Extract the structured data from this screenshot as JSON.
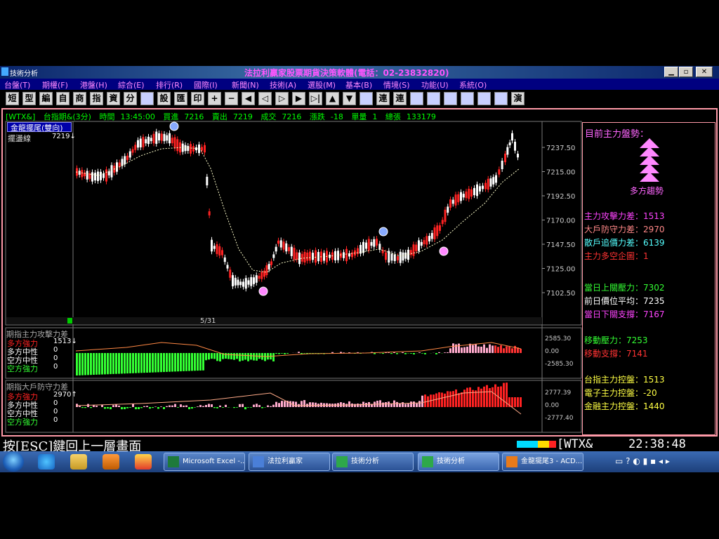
{
  "window": {
    "app_label": "技術分析",
    "title": "法拉利贏家股票期貨決策軟體(電話：02-23832820)",
    "min": "▁",
    "max": "▫",
    "close": "✕"
  },
  "menu": [
    "台盤(T)",
    "期權(F)",
    "港盤(H)",
    "綜合(E)",
    "排行(R)",
    "國際(I)",
    "新聞(N)",
    "技術(A)",
    "選股(M)",
    "基本(B)",
    "情境(S)",
    "功能(U)",
    "系統(O)"
  ],
  "toolbar": [
    "短",
    "型",
    "編",
    "自",
    "商",
    "指",
    "資",
    "分",
    "",
    "設",
    "匯",
    "印",
    "+",
    "−",
    "◀",
    "◁",
    "▷",
    "▶",
    "▷|",
    "▲",
    "▼",
    "",
    "連",
    "連",
    "",
    "",
    "",
    "",
    "",
    "",
    " 演"
  ],
  "infobar": {
    "symbol": "[WTX&]",
    "name": "台指期&(3分)",
    "time_label": "時間",
    "time": "13:45:00",
    "bid_label": "買進",
    "bid": "7216",
    "ask_label": "賣出",
    "ask": "7219",
    "deal_label": "成交",
    "deal": "7216",
    "chg_label": "漲跌",
    "chg": "-18",
    "vol_label": "單量",
    "vol": "1",
    "total_label": "總張",
    "total": "133179"
  },
  "main_panel": {
    "indicator_title": "金龍擺尾(雙向)",
    "filter_label": "擺盪線",
    "filter_value": "7219↓",
    "date_label": "5/31",
    "y_ticks": [
      "7237.50",
      "7215.00",
      "7192.50",
      "7170.00",
      "7147.50",
      "7125.00",
      "7102.50"
    ]
  },
  "attack_panel": {
    "title": "期指主力攻擊力差",
    "rows": [
      {
        "label": "多方強力",
        "value": "1513↓"
      },
      {
        "label": "多方中性",
        "value": "0"
      },
      {
        "label": "空方中性",
        "value": "0"
      },
      {
        "label": "空方強力",
        "value": "0"
      }
    ],
    "y_ticks": [
      "2585.30",
      "0.00",
      "-2585.30"
    ]
  },
  "defense_panel": {
    "title": "期指大戶防守力差",
    "rows": [
      {
        "label": "多方強力",
        "value": "2970↑"
      },
      {
        "label": "多方中性",
        "value": "0"
      },
      {
        "label": "空方中性",
        "value": "0"
      },
      {
        "label": "空方強力",
        "value": "0"
      }
    ],
    "y_ticks": [
      "2777.39",
      "0.00",
      "-2777.40"
    ]
  },
  "right_panel": {
    "trend_title": "目前主力盤勢：",
    "trend_label": "多方趨勢",
    "stats": [
      {
        "label": "主力攻擊力差：",
        "value": "1513",
        "color": "#ff44ff"
      },
      {
        "label": "大戶防守力差：",
        "value": "2970",
        "color": "#ff8888"
      },
      {
        "label": "散戶追價力差：",
        "value": "6139",
        "color": "#55ffff"
      },
      {
        "label": "主力多空企圖：",
        "value": "1",
        "color": "#ff3333"
      }
    ],
    "levels": [
      {
        "label": "當日上關壓力：",
        "value": "7302",
        "color": "#33ff33"
      },
      {
        "label": "前日價位平均：",
        "value": "7235",
        "color": "#ffffff"
      },
      {
        "label": "當日下關支撐：",
        "value": "7167",
        "color": "#ff44ff"
      }
    ],
    "moves": [
      {
        "label": "移動壓力：",
        "value": "7253",
        "color": "#33ff33"
      },
      {
        "label": "移動支撐：",
        "value": "7141",
        "color": "#ff3333"
      }
    ],
    "control": [
      {
        "label": "台指主力控盤：",
        "value": "1513",
        "color": "#ffff44"
      },
      {
        "label": "電子主力控盤：",
        "value": "-20",
        "color": "#ffff44"
      },
      {
        "label": "金融主力控盤：",
        "value": "1440",
        "color": "#ffff44"
      }
    ]
  },
  "status": {
    "esc_text": "按[ESC]鍵回上一層畫面",
    "ticker": "[WTX&",
    "clock": "22:38:48"
  },
  "taskbar": {
    "tasks": [
      "Microsoft Excel -...",
      "法拉利贏家",
      "技術分析",
      "技術分析",
      "金龍擺尾3 - ACD..."
    ]
  },
  "colors": {
    "bull": "#ff2222",
    "bear": "#ffffff",
    "green_bar": "#33ff33",
    "pink_bar": "#ffaacc",
    "ma": "#ffffcc",
    "frame": "#ff9aa8"
  }
}
